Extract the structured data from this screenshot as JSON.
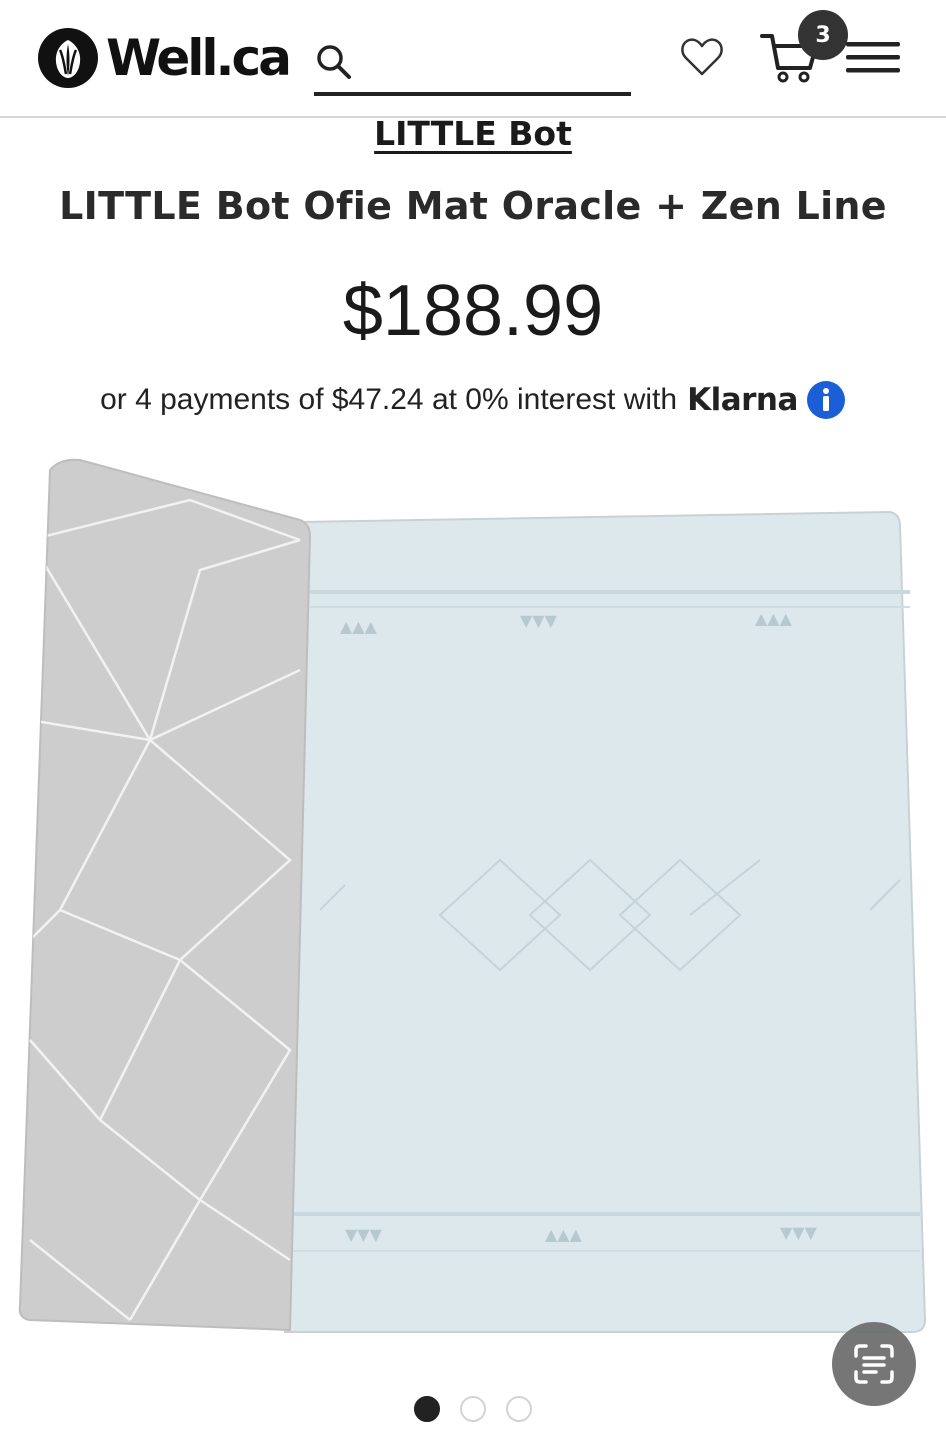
{
  "header": {
    "logo_text": "Well.ca",
    "search_placeholder": "",
    "cart_count": "3"
  },
  "product": {
    "brand": "LITTLE Bot",
    "title": "LITTLE Bot Ofie Mat Oracle + Zen Line",
    "price": "$188.99",
    "financing": {
      "text": "or 4 payments of $47.24 at 0% interest with",
      "provider": "Klarna"
    }
  },
  "gallery": {
    "total_images": 3,
    "active_index": 0
  },
  "icons": {
    "logo": "tulip-logo-icon",
    "search": "search-icon",
    "wishlist": "heart-icon",
    "cart": "cart-icon",
    "menu": "hamburger-menu-icon",
    "info": "info-icon",
    "scan": "scan-text-icon"
  },
  "colors": {
    "klarna_info": "#1a5fd6",
    "header_border": "#d6d6d6",
    "mat_left": "#cfcfcf",
    "mat_right": "#dfe9ee"
  }
}
